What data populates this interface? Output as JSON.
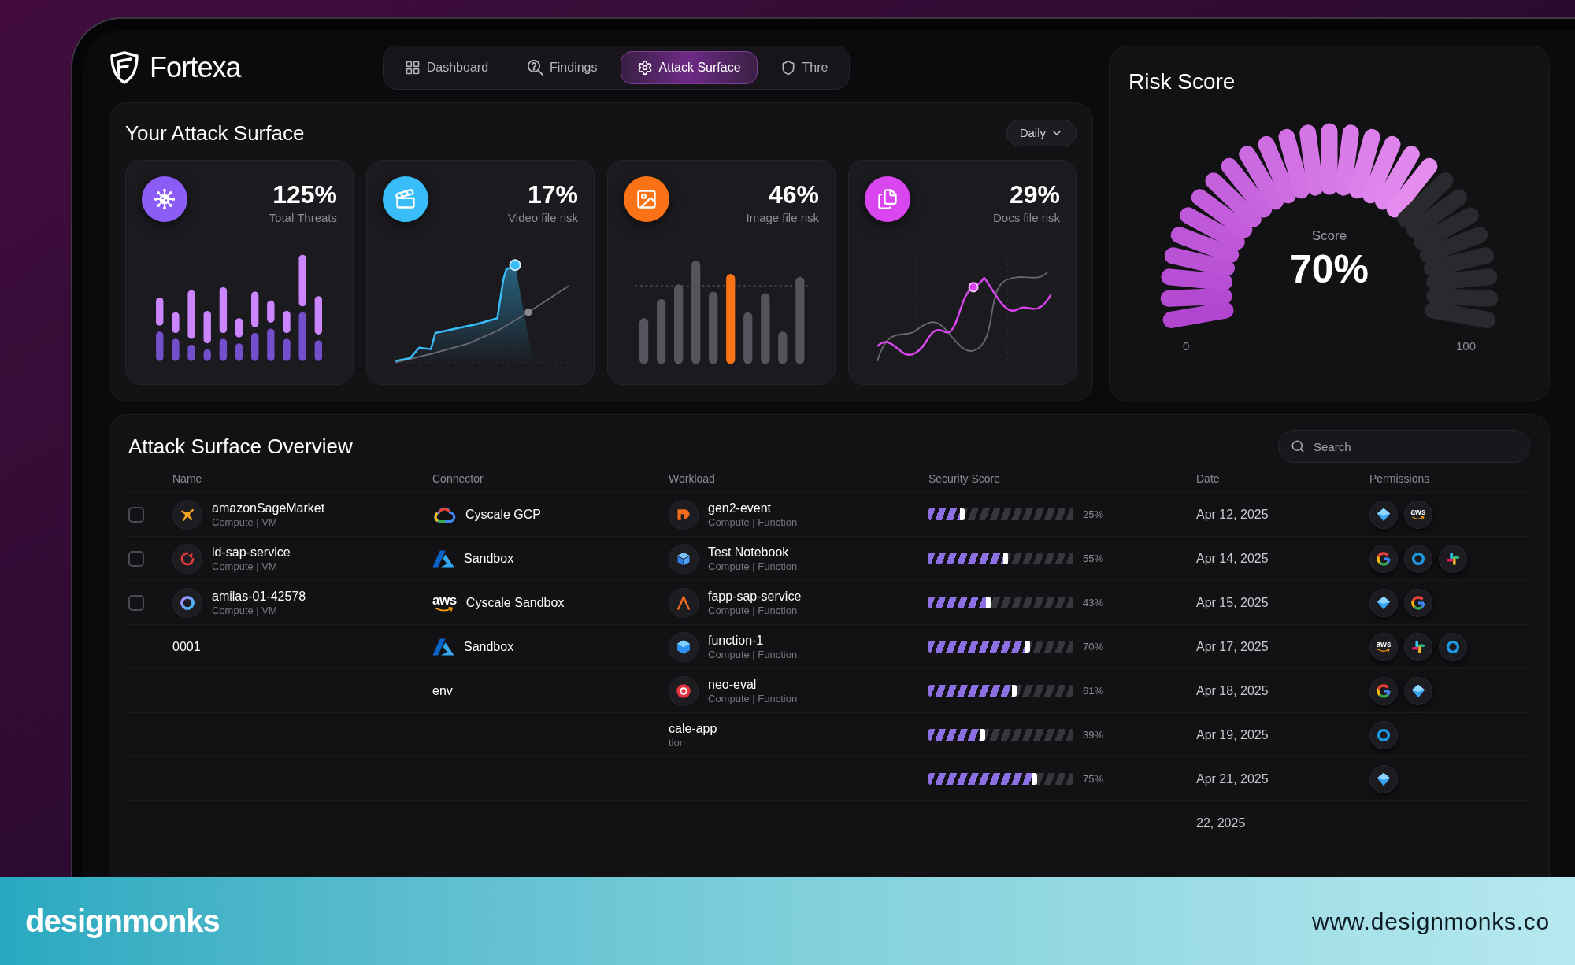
{
  "brand": {
    "name": "Fortexa"
  },
  "nav": {
    "tabs": [
      {
        "label": "Dashboard",
        "selected": false
      },
      {
        "label": "Findings",
        "selected": false
      },
      {
        "label": "Attack Surface",
        "selected": true
      },
      {
        "label": "Thre",
        "selected": false
      }
    ]
  },
  "attack_surface": {
    "title": "Your Attack Surface",
    "period": "Daily",
    "cards": [
      {
        "kind": "pairs",
        "value": "125%",
        "label": "Total Threats",
        "color": "#8b5cf6"
      },
      {
        "kind": "area",
        "value": "17%",
        "label": "Video file risk",
        "color": "#38bdf8"
      },
      {
        "kind": "bars",
        "value": "46%",
        "label": "Image file risk",
        "color": "#f97316"
      },
      {
        "kind": "waves",
        "value": "29%",
        "label": "Docs file risk",
        "color": "#d946ef"
      }
    ]
  },
  "risk_score": {
    "title": "Risk Score",
    "caption": "Score",
    "value": "70%",
    "level": 0.7,
    "min_label": "0",
    "max_label": "100"
  },
  "overview": {
    "title": "Attack Surface Overview",
    "search": {
      "placeholder": "Search"
    },
    "columns": [
      "Name",
      "Connector",
      "Workload",
      "Security Score",
      "Date",
      "Permissions"
    ],
    "rows": [
      {
        "checked": false,
        "name": {
          "title": "amazonSageMarket",
          "subtitle": "Compute | VM"
        },
        "connector": {
          "kind": "gcp",
          "label": "Cyscale GCP"
        },
        "workload": {
          "title": "gen2-event",
          "subtitle": "Compute | Function"
        },
        "score": {
          "level": 0.25,
          "reading": "25%"
        },
        "date": "Apr 12, 2025",
        "permissions": [
          {
            "kind": "diamond"
          },
          {
            "kind": "aws",
            "text": "aws"
          }
        ]
      },
      {
        "checked": false,
        "name": {
          "title": "id-sap-service",
          "subtitle": "Compute | VM"
        },
        "connector": {
          "kind": "azure",
          "label": "Sandbox"
        },
        "workload": {
          "title": "Test Notebook",
          "subtitle": "Compute | Function"
        },
        "score": {
          "level": 0.55,
          "reading": "55%"
        },
        "date": "Apr 14, 2025",
        "permissions": [
          {
            "kind": "google"
          },
          {
            "kind": "ring"
          },
          {
            "kind": "pinwheel"
          }
        ]
      },
      {
        "checked": false,
        "name": {
          "title": "amilas-01-42578",
          "subtitle": "Compute | VM"
        },
        "connector": {
          "kind": "aws",
          "label": "Cyscale Sandbox",
          "logo_text": "aws"
        },
        "workload": {
          "title": "fapp-sap-service",
          "subtitle": "Compute | Function"
        },
        "score": {
          "level": 0.43,
          "reading": "43%"
        },
        "date": "Apr 15, 2025",
        "permissions": [
          {
            "kind": "diamond"
          },
          {
            "kind": "google"
          }
        ]
      },
      {
        "name": {
          "title": "0001"
        },
        "connector": {
          "kind": "azure",
          "label": "Sandbox"
        },
        "workload": {
          "title": "function-1",
          "subtitle": "Compute | Function"
        },
        "score": {
          "level": 0.7,
          "reading": "70%"
        },
        "date": "Apr 17, 2025",
        "permissions": [
          {
            "kind": "aws",
            "text": "aws"
          },
          {
            "kind": "pinwheel"
          },
          {
            "kind": "ring"
          }
        ]
      },
      {
        "connector": {
          "label": "env"
        },
        "workload": {
          "title": "neo-eval",
          "subtitle": "Compute | Function"
        },
        "score": {
          "level": 0.61,
          "reading": "61%"
        },
        "date": "Apr 18, 2025",
        "permissions": [
          {
            "kind": "google"
          },
          {
            "kind": "diamond"
          }
        ]
      },
      {
        "workload": {
          "title": "cale-app",
          "subtitle": "tion"
        },
        "score": {
          "level": 0.39,
          "reading": "39%"
        },
        "date": "Apr 19, 2025",
        "permissions": [
          {
            "kind": "ring"
          }
        ]
      },
      {
        "score": {
          "level": 0.75,
          "reading": "75%"
        },
        "date": "Apr 21, 2025",
        "permissions": [
          {
            "kind": "diamond"
          }
        ]
      },
      {
        "date": "22, 2025"
      }
    ]
  },
  "banner": {
    "brand": "designmonks",
    "url": "www.designmonks.co"
  }
}
